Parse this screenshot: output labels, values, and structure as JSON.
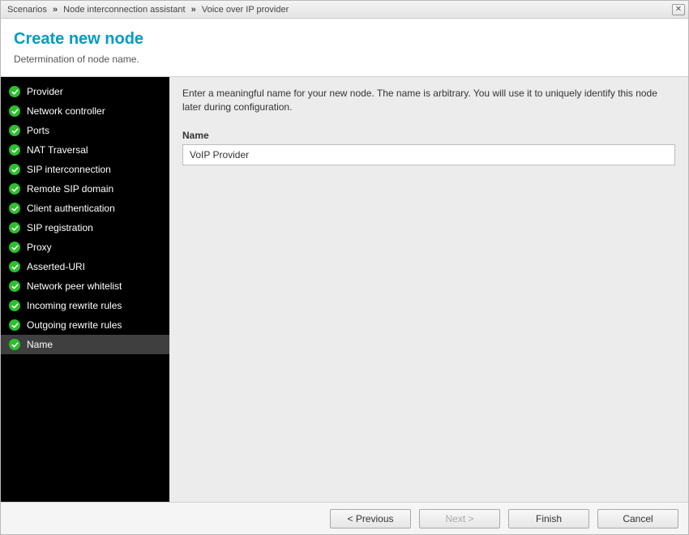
{
  "title": {
    "crumb1": "Scenarios",
    "crumb2": "Node interconnection assistant",
    "crumb3": "Voice over IP provider",
    "sep": "»"
  },
  "header": {
    "title": "Create new node",
    "subtitle": "Determination of node name."
  },
  "sidebar": {
    "steps": [
      {
        "label": "Provider",
        "done": true,
        "active": false
      },
      {
        "label": "Network controller",
        "done": true,
        "active": false
      },
      {
        "label": "Ports",
        "done": true,
        "active": false
      },
      {
        "label": "NAT Traversal",
        "done": true,
        "active": false
      },
      {
        "label": "SIP interconnection",
        "done": true,
        "active": false
      },
      {
        "label": "Remote SIP domain",
        "done": true,
        "active": false
      },
      {
        "label": "Client authentication",
        "done": true,
        "active": false
      },
      {
        "label": "SIP registration",
        "done": true,
        "active": false
      },
      {
        "label": "Proxy",
        "done": true,
        "active": false
      },
      {
        "label": "Asserted-URI",
        "done": true,
        "active": false
      },
      {
        "label": "Network peer whitelist",
        "done": true,
        "active": false
      },
      {
        "label": "Incoming rewrite rules",
        "done": true,
        "active": false
      },
      {
        "label": "Outgoing rewrite rules",
        "done": true,
        "active": false
      },
      {
        "label": "Name",
        "done": true,
        "active": true
      }
    ]
  },
  "panel": {
    "description": "Enter a meaningful name for your new node. The name is arbitrary. You will use it to uniquely identify this node later during configuration.",
    "name_label": "Name",
    "name_value": "VoIP Provider"
  },
  "footer": {
    "previous": "< Previous",
    "next": "Next >",
    "finish": "Finish",
    "cancel": "Cancel",
    "next_disabled": true
  }
}
